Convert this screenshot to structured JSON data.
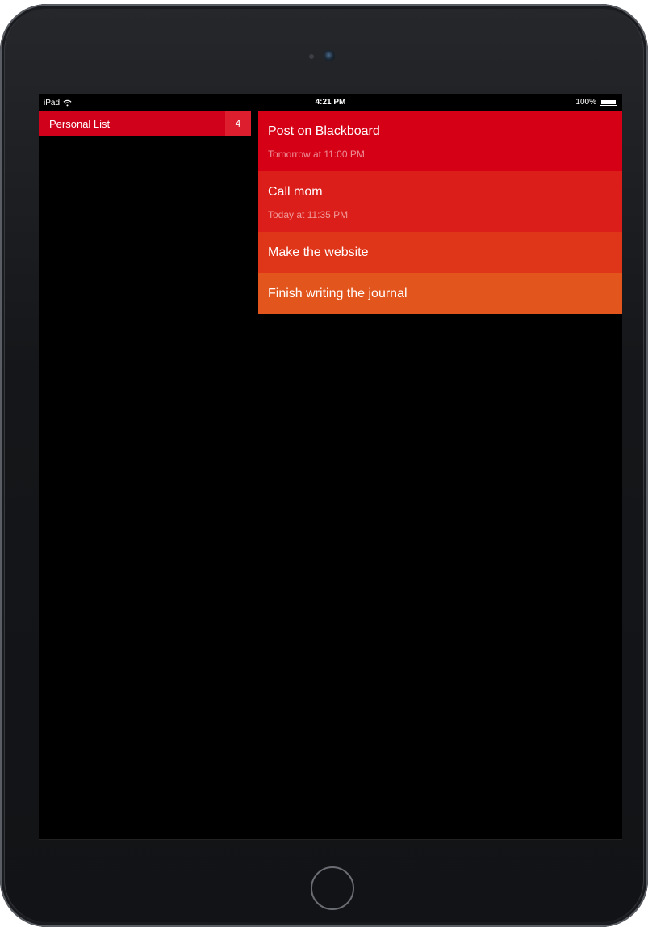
{
  "status_bar": {
    "device": "iPad",
    "time": "4:21 PM",
    "battery": "100%",
    "battery_level": 1.0
  },
  "sidebar": {
    "lists": [
      {
        "name": "Personal List",
        "count": "4"
      }
    ]
  },
  "tasks": [
    {
      "title": "Post on Blackboard",
      "due": "Tomorrow at 11:00 PM",
      "color": "#d50015"
    },
    {
      "title": "Call mom",
      "due": "Today at 11:35 PM",
      "color": "#dc1e1a"
    },
    {
      "title": "Make the website",
      "due": "",
      "color": "#df361a"
    },
    {
      "title": "Finish writing the journal",
      "due": "",
      "color": "#e2551d"
    }
  ],
  "icons": {
    "wifi": "wifi-icon",
    "battery": "battery-icon"
  }
}
